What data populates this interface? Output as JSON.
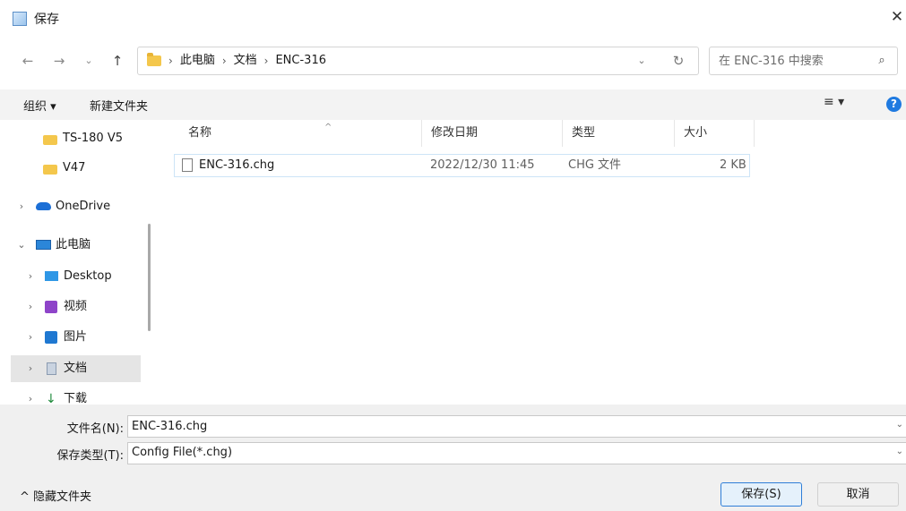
{
  "window": {
    "title": "保存",
    "close_glyph": "✕",
    "title_icon": "save-dialog-app-icon"
  },
  "nav_buttons": {
    "back": "←",
    "forward": "→",
    "recent": "⌄",
    "up": "↑"
  },
  "address": {
    "crumbs": [
      "此电脑",
      "文档",
      "ENC-316"
    ],
    "separator": "›",
    "dropdown": "⌄",
    "refresh": "↻"
  },
  "search": {
    "placeholder": "在 ENC-316 中搜索",
    "icon": "⌕"
  },
  "toolbar": {
    "organize": "组织 ▾",
    "new_folder": "新建文件夹",
    "view": "≡ ▾",
    "help": "?"
  },
  "nav_pane": {
    "items": [
      {
        "label": "TS-180 V5",
        "icon": "folder-icon"
      },
      {
        "label": "V47",
        "icon": "folder-icon"
      },
      {
        "label": "OneDrive",
        "icon": "cloud-icon"
      },
      {
        "label": "此电脑",
        "icon": "computer-icon"
      },
      {
        "label": "Desktop",
        "icon": "desktop-icon"
      },
      {
        "label": "视频",
        "icon": "video-icon"
      },
      {
        "label": "图片",
        "icon": "pictures-icon"
      },
      {
        "label": "文档",
        "icon": "documents-icon"
      },
      {
        "label": "下载",
        "icon": "download-icon"
      }
    ],
    "expand_glyph": "›",
    "collapse_glyph": "⌄"
  },
  "columns": {
    "name": "名称",
    "modified": "修改日期",
    "type": "类型",
    "size": "大小",
    "sort_glyph": "^"
  },
  "files": [
    {
      "name": "ENC-316.chg",
      "modified": "2022/12/30 11:45",
      "type": "CHG 文件",
      "size": "2 KB"
    }
  ],
  "fields": {
    "filename_label": "文件名(N):",
    "filename_value": "ENC-316.chg",
    "filetype_label": "保存类型(T):",
    "filetype_value": "Config File(*.chg)",
    "chevron": "⌄"
  },
  "footer": {
    "hide_folders": "^ 隐藏文件夹",
    "save": "保存(S)",
    "cancel": "取消"
  },
  "colors": {
    "folder": "#f4c74c",
    "accent": "#1f7ae0",
    "selected_bg": "#e5e5e5"
  }
}
